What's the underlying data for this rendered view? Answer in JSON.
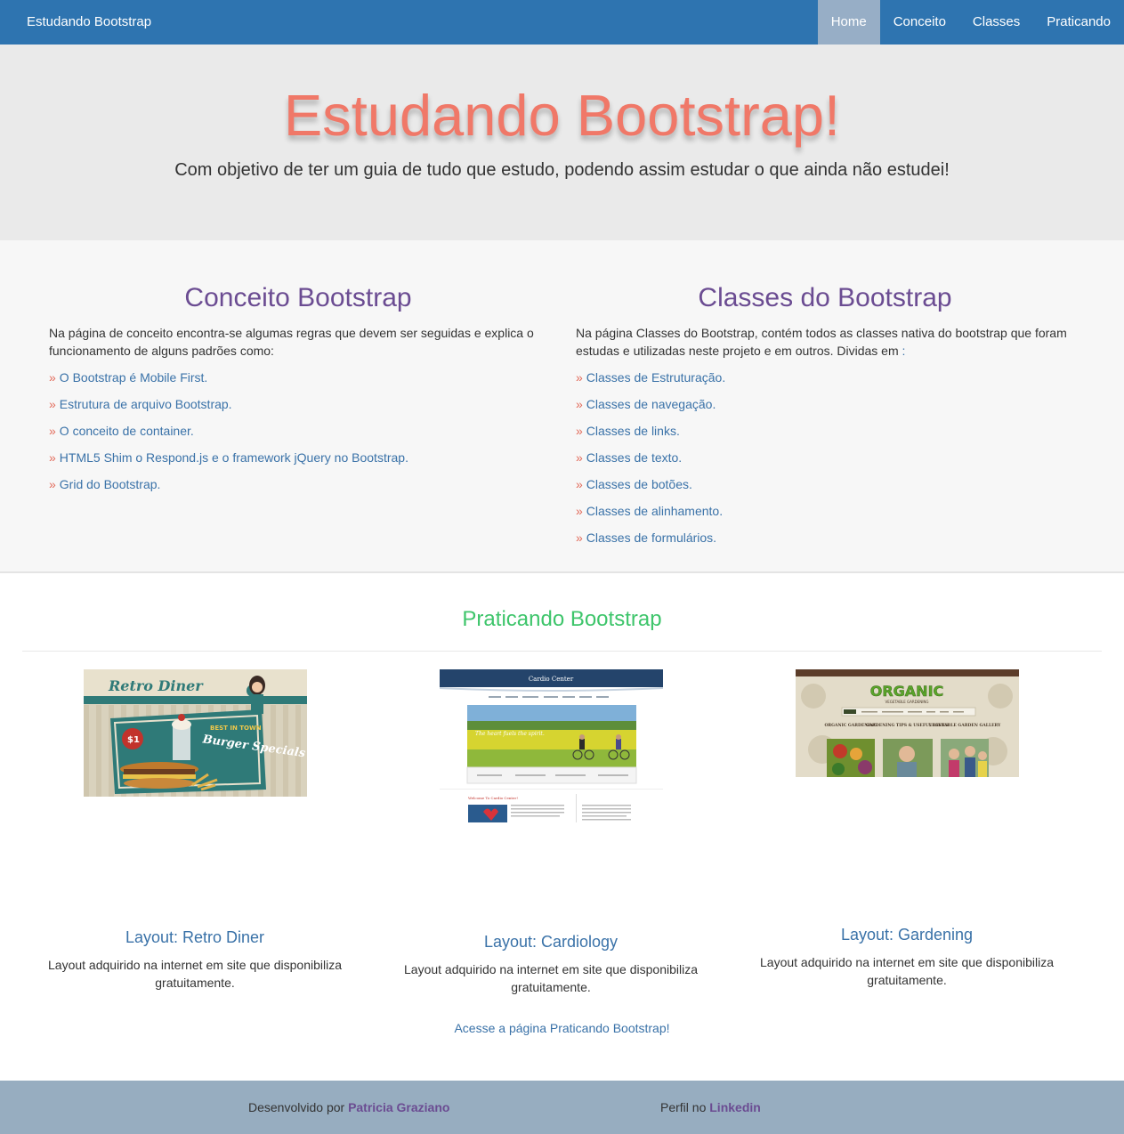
{
  "navbar": {
    "brand": "Estudando Bootstrap",
    "items": [
      {
        "label": "Home"
      },
      {
        "label": "Conceito"
      },
      {
        "label": "Classes"
      },
      {
        "label": "Praticando"
      }
    ]
  },
  "jumbotron": {
    "title": "Estudando Bootstrap!",
    "subtitle": "Com objetivo de ter um guia de tudo que estudo, podendo assim estudar o que ainda não estudei!"
  },
  "concept": {
    "title": "Conceito Bootstrap",
    "description": "Na página de conceito encontra-se algumas regras que devem ser seguidas e explica o funcionamento de alguns padrões como:",
    "bullet": "»",
    "links": [
      "O Bootstrap é Mobile First.",
      "Estrutura de arquivo Bootstrap.",
      "O conceito de container.",
      "HTML5 Shim o Respond.js e o framework jQuery no Bootstrap.",
      "Grid do Bootstrap."
    ]
  },
  "classes": {
    "title": "Classes do Bootstrap",
    "description": "Na página Classes do Bootstrap, contém todos as classes nativa do bootstrap que foram estudas e utilizadas neste projeto e em outros. Dividas em",
    "description_colon": ":",
    "bullet": "»",
    "links": [
      "Classes de Estruturação.",
      "Classes de navegação.",
      "Classes de links.",
      "Classes de texto.",
      "Classes de botões.",
      "Classes de alinhamento.",
      "Classes de formulários."
    ]
  },
  "practice": {
    "title": "Praticando Bootstrap",
    "cards": [
      {
        "thumb_logo": "Retro Diner",
        "thumb_tag": "BEST IN TOWN",
        "thumb_price": "$1",
        "thumb_headline": "Burger Specials",
        "title": "Layout: Retro Diner",
        "description": "Layout adquirido na internet em site que disponibiliza gratuitamente."
      },
      {
        "thumb_logo": "Cardio Center",
        "thumb_caption": "The heart fuels the spirit.",
        "thumb_welcome": "Welcome To Cardio Center!",
        "title": "Layout: Cardiology",
        "description": "Layout adquirido na internet em site que disponibiliza gratuitamente."
      },
      {
        "thumb_logo": "ORGANIC",
        "thumb_tagline": "VEGETABLE GARDENING",
        "thumb_cols": [
          "ORGANIC GARDENING",
          "GARDENING TIPS & USEFUL LINKS",
          "VEGETABLE GARDEN GALLERY"
        ],
        "title": "Layout: Gardening",
        "description": "Layout adquirido na internet em site que disponibiliza gratuitamente."
      }
    ],
    "access_text": "Acesse a página Praticando Bootstrap",
    "access_bang": "!"
  },
  "footer": {
    "dev_prefix": "Desenvolvido por",
    "dev_name": "Patricia Graziano",
    "profile_prefix": "Perfil no",
    "profile_link": "Linkedin"
  },
  "colors": {
    "navbar": "#2e74b0",
    "active_nav": "#97aec6",
    "jumbo_title": "#f07868",
    "section_title": "#6b4c92",
    "link": "#3a72a8",
    "bullet": "#e26a5a",
    "practice_title": "#3ec56b",
    "footer": "#97adc0"
  }
}
